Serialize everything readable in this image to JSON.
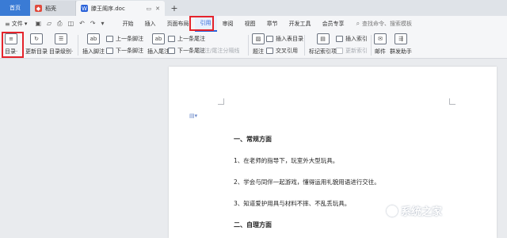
{
  "titlebar": {
    "home_tab": "首页",
    "tabs": [
      {
        "label": "稻壳",
        "icon": "docer-icon"
      },
      {
        "label": "滕王阁序.doc",
        "icon": "word-doc-icon"
      }
    ],
    "new_tab_glyph": "+"
  },
  "menubar": {
    "file_label": "文件",
    "tabs": [
      "开始",
      "插入",
      "页面布局",
      "引用",
      "审阅",
      "视图",
      "章节",
      "开发工具",
      "会员专享"
    ],
    "active_tab": "引用",
    "search_placeholder": "查找命令、搜索模板"
  },
  "ribbon": {
    "toc": "目录·",
    "update_toc": "更新目录",
    "toc_level": "目录级别·",
    "insert_footnote": "插入脚注",
    "prev_footnote": "上一条脚注",
    "next_footnote": "下一条脚注",
    "insert_endnote": "插入尾注",
    "prev_endnote": "上一条尾注",
    "next_endnote": "下一条尾注",
    "footnote_separator": "脚注/尾注分隔线",
    "caption": "题注",
    "insert_table_of_figures": "插入表目录",
    "cross_reference": "交叉引用",
    "mark_index_entry": "标记索引项",
    "insert_index": "插入索引",
    "update_index": "更新索引",
    "mail": "邮件",
    "mass_mailing_assistant": "群发助手"
  },
  "document": {
    "lines": [
      {
        "text": "一、常规方面",
        "heading": true
      },
      {
        "text": "1、在老师的指导下，玩室外大型玩具。",
        "heading": false
      },
      {
        "text": "2、学会与同伴一起游戏，懂得运用礼貌用语进行交往。",
        "heading": false
      },
      {
        "text": "3、知道爱护用具与材料不摔、不乱丢玩具。",
        "heading": false
      },
      {
        "text": "二、自理方面",
        "heading": true
      }
    ]
  },
  "watermark": "系统之家",
  "colors": {
    "accent": "#2b63d9",
    "highlight_box": "#e5232b",
    "home_tab": "#3a7bd5"
  }
}
